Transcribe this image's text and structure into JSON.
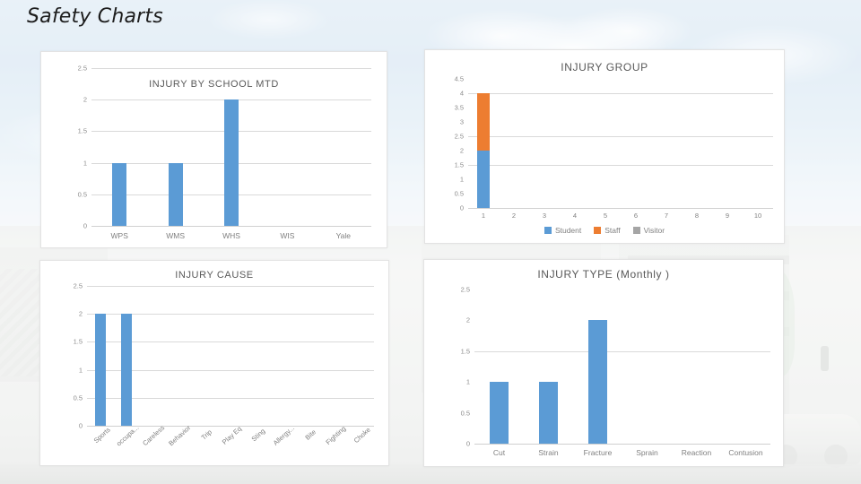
{
  "slide": {
    "title": "Safety Charts"
  },
  "colors": {
    "series_student": "#5B9BD5",
    "series_staff": "#ED7D31",
    "series_visitor": "#A5A5A5",
    "bar_blue": "#5B9BD5",
    "gridline": "#D9D9D9",
    "axis_text": "#808080",
    "title_text": "#595959",
    "card_background": "#FFFFFF"
  },
  "chart_data": [
    {
      "id": "injury_by_school_mtd",
      "type": "bar",
      "title": "INJURY BY SCHOOL MTD",
      "xlabel": "",
      "ylabel": "",
      "categories": [
        "WPS",
        "WMS",
        "WHS",
        "WIS",
        "Yale"
      ],
      "values": [
        1,
        1,
        2,
        0,
        0
      ],
      "yticks": [
        "0",
        "0.5",
        "1",
        "1.5",
        "2",
        "2.5"
      ],
      "ylim": [
        0,
        2.5
      ],
      "grid": true,
      "legend": "none"
    },
    {
      "id": "injury_group",
      "type": "bar",
      "subtype": "stacked",
      "title": "INJURY GROUP",
      "xlabel": "",
      "ylabel": "",
      "categories": [
        "1",
        "2",
        "3",
        "4",
        "5",
        "6",
        "7",
        "8",
        "9",
        "10"
      ],
      "series": [
        {
          "name": "Student",
          "color": "#5B9BD5",
          "values": [
            2,
            0,
            0,
            0,
            0,
            0,
            0,
            0,
            0,
            0
          ]
        },
        {
          "name": "Staff",
          "color": "#ED7D31",
          "values": [
            2,
            0,
            0,
            0,
            0,
            0,
            0,
            0,
            0,
            0
          ]
        },
        {
          "name": "Visitor",
          "color": "#A5A5A5",
          "values": [
            0,
            0,
            0,
            0,
            0,
            0,
            0,
            0,
            0,
            0
          ]
        }
      ],
      "yticks": [
        "0",
        "0.5",
        "1",
        "1.5",
        "2",
        "2.5",
        "3",
        "3.5",
        "4",
        "4.5"
      ],
      "ylim": [
        0,
        4.5
      ],
      "grid": true,
      "legend": "bottom"
    },
    {
      "id": "injury_cause",
      "type": "bar",
      "title": "INJURY CAUSE",
      "xlabel": "",
      "ylabel": "",
      "categories": [
        "Sports",
        "occupa...",
        "Careless",
        "Behavior",
        "Trip",
        "Play Eq",
        "Sting",
        "Allergy...",
        "Bite",
        "Fighting",
        "Choke"
      ],
      "values": [
        2,
        2,
        0,
        0,
        0,
        0,
        0,
        0,
        0,
        0,
        0
      ],
      "yticks": [
        "0",
        "0.5",
        "1",
        "1.5",
        "2",
        "2.5"
      ],
      "ylim": [
        0,
        2.5
      ],
      "grid": true,
      "legend": "none"
    },
    {
      "id": "injury_type_monthly",
      "type": "bar",
      "title": "INJURY TYPE (Monthly )",
      "xlabel": "",
      "ylabel": "",
      "categories": [
        "Cut",
        "Strain",
        "Fracture",
        "Sprain",
        "Reaction",
        "Contusion"
      ],
      "values": [
        1,
        1,
        2,
        0,
        0,
        0
      ],
      "yticks": [
        "0",
        "0.5",
        "1",
        "1.5",
        "2",
        "2.5"
      ],
      "ylim": [
        0,
        2.5
      ],
      "grid": true,
      "legend": "none"
    }
  ]
}
